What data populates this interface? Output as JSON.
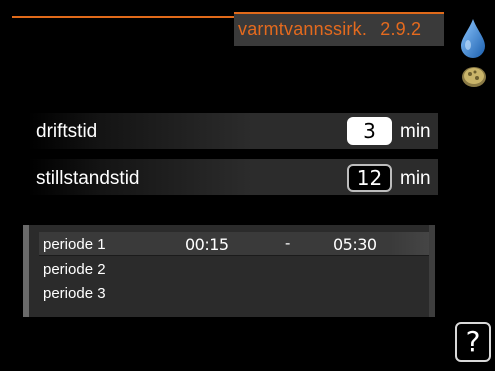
{
  "header": {
    "title": "varmtvannssirk.",
    "menu_number": "2.9.2",
    "accent_color": "#e06a1a"
  },
  "side_icons": [
    "water-drop-icon",
    "compressor-icon"
  ],
  "settings": [
    {
      "label": "driftstid",
      "value": "3",
      "unit": "min",
      "selected": true
    },
    {
      "label": "stillstandstid",
      "value": "12",
      "unit": "min",
      "selected": false
    }
  ],
  "periods": [
    {
      "name": "periode 1",
      "start": "00:15",
      "dash": "-",
      "end": "05:30"
    },
    {
      "name": "periode 2",
      "start": "",
      "dash": "",
      "end": ""
    },
    {
      "name": "periode 3",
      "start": "",
      "dash": "",
      "end": ""
    }
  ],
  "help": {
    "label": "?"
  }
}
